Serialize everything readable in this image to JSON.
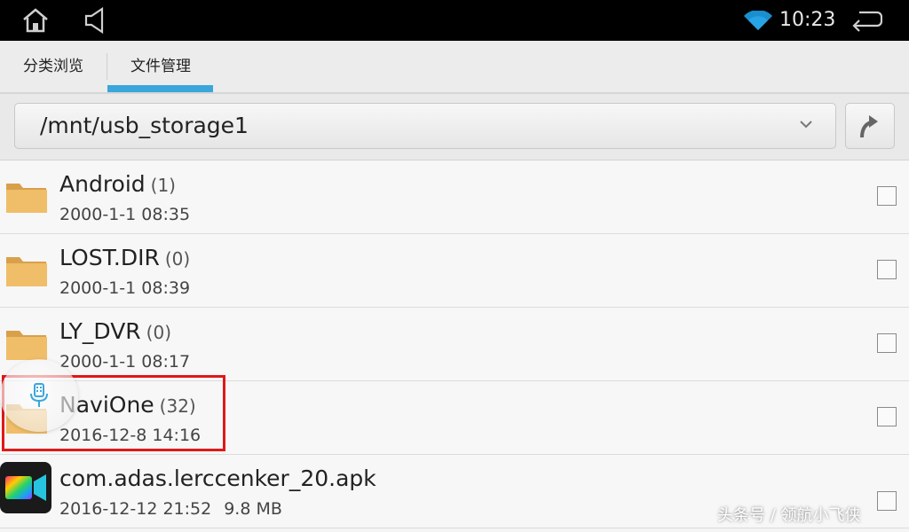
{
  "status_bar": {
    "time": "10:23",
    "icons": [
      "home-icon",
      "volume-icon",
      "wifi-icon",
      "back-icon"
    ]
  },
  "tabs": [
    {
      "label": "分类浏览",
      "selected": false
    },
    {
      "label": "文件管理",
      "selected": true
    }
  ],
  "accent_color": "#3aa7dc",
  "path": {
    "value": "/mnt/usb_storage1"
  },
  "files": [
    {
      "name": "Android",
      "count": "(1)",
      "date": "2000-1-1 08:35",
      "size": "",
      "type": "folder",
      "checked": false
    },
    {
      "name": "LOST.DIR",
      "count": "(0)",
      "date": "2000-1-1 08:39",
      "size": "",
      "type": "folder",
      "checked": false
    },
    {
      "name": "LY_DVR",
      "count": "(0)",
      "date": "2000-1-1 08:17",
      "size": "",
      "type": "folder",
      "checked": false
    },
    {
      "name": "NaviOne",
      "count": "(32)",
      "date": "2016-12-8 14:16",
      "size": "",
      "type": "folder",
      "checked": false
    },
    {
      "name": "com.adas.lerccenker_20.apk",
      "count": "",
      "date": "2016-12-12 21:52",
      "size": "9.8 MB",
      "type": "apk",
      "checked": false
    }
  ],
  "watermark": "头条号 / 领航小飞侠"
}
